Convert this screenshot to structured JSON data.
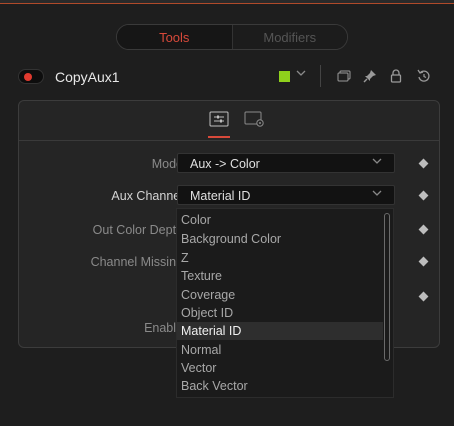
{
  "tabs": [
    {
      "label": "Tools",
      "active": true
    },
    {
      "label": "Modifiers",
      "active": false
    }
  ],
  "header": {
    "node_name": "CopyAux1",
    "color_swatch": "#8fd11c",
    "icons": [
      "toggle-icon",
      "chevron-down-icon",
      "versions-icon",
      "pin-icon",
      "lock-icon",
      "reset-icon"
    ]
  },
  "page_tabs": [
    {
      "icon": "sliders-icon",
      "active": true
    },
    {
      "icon": "settings-gear-icon",
      "active": false
    }
  ],
  "controls": {
    "mode": {
      "label": "Mode",
      "value": "Aux -> Color"
    },
    "aux_channel": {
      "label": "Aux Channel",
      "value": "Material ID"
    },
    "out_color_depth": {
      "label": "Out Color Depth"
    },
    "channel_missing": {
      "label": "Channel Missing"
    },
    "enable": {
      "label": "Enable"
    }
  },
  "dropdown": {
    "options": [
      "Color",
      "Background Color",
      "Z",
      "Texture",
      "Coverage",
      "Object ID",
      "Material ID",
      "Normal",
      "Vector",
      "Back Vector"
    ],
    "selected": "Material ID"
  },
  "colors": {
    "accent": "#d8493a",
    "enable_dot": "#e03a2f"
  }
}
